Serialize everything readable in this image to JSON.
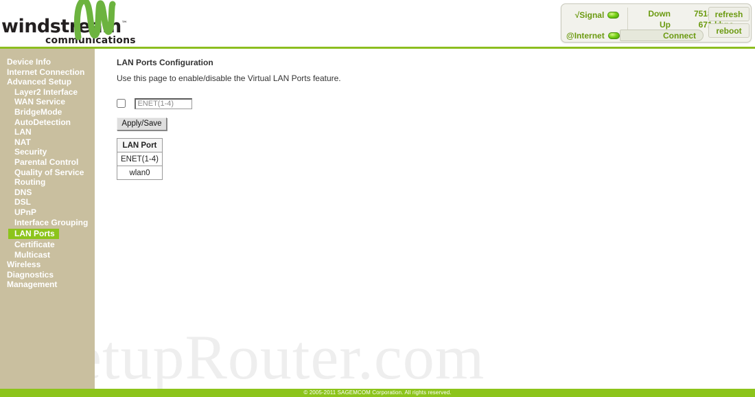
{
  "brand": {
    "name": "windstream",
    "trademark": "™",
    "tagline": "communications",
    "logo_icon": "windstream-wave-logo",
    "logo_color": "#6cb33f"
  },
  "status_panel": {
    "signal_label": "√Signal",
    "signal_led": "green",
    "internet_label": "@Internet",
    "internet_led": "green",
    "connect_label": "Connect",
    "rates": [
      {
        "name": "Down",
        "value": "7518 kbps"
      },
      {
        "name": "Up",
        "value": "671 kbps"
      }
    ],
    "buttons": [
      {
        "label": "refresh",
        "name": "refresh-button"
      },
      {
        "label": "reboot",
        "name": "reboot-button"
      }
    ],
    "accent_color": "#6b9a10"
  },
  "sidebar": {
    "background_color": "#c9bf9f",
    "active_color": "#8cc41b",
    "items": [
      {
        "label": "Device Info",
        "level": 1,
        "active": false
      },
      {
        "label": "Internet Connection",
        "level": 1,
        "active": false
      },
      {
        "label": "Advanced Setup",
        "level": 1,
        "active": false
      },
      {
        "label": "Layer2 Interface",
        "level": 2,
        "active": false
      },
      {
        "label": "WAN Service",
        "level": 2,
        "active": false
      },
      {
        "label": "BridgeMode",
        "level": 2,
        "active": false
      },
      {
        "label": "AutoDetection",
        "level": 2,
        "active": false
      },
      {
        "label": "LAN",
        "level": 2,
        "active": false
      },
      {
        "label": "NAT",
        "level": 2,
        "active": false
      },
      {
        "label": "Security",
        "level": 2,
        "active": false
      },
      {
        "label": "Parental Control",
        "level": 2,
        "active": false
      },
      {
        "label": "Quality of Service",
        "level": 2,
        "active": false
      },
      {
        "label": "Routing",
        "level": 2,
        "active": false
      },
      {
        "label": "DNS",
        "level": 2,
        "active": false
      },
      {
        "label": "DSL",
        "level": 2,
        "active": false
      },
      {
        "label": "UPnP",
        "level": 2,
        "active": false
      },
      {
        "label": "Interface Grouping",
        "level": 2,
        "active": false
      },
      {
        "label": "LAN Ports",
        "level": 2,
        "active": true
      },
      {
        "label": "Certificate",
        "level": 2,
        "active": false
      },
      {
        "label": "Multicast",
        "level": 2,
        "active": false
      },
      {
        "label": "Wireless",
        "level": 1,
        "active": false
      },
      {
        "label": "Diagnostics",
        "level": 1,
        "active": false
      },
      {
        "label": "Management",
        "level": 1,
        "active": false
      }
    ]
  },
  "main": {
    "title": "LAN Ports Configuration",
    "description": "Use this page to enable/disable the Virtual LAN Ports feature.",
    "vlan_enable": {
      "checked": false,
      "input_value": "ENET(1-4)"
    },
    "apply_save_label": "Apply/Save",
    "table": {
      "header": "LAN Port",
      "rows": [
        "ENET(1-4)",
        "wlan0"
      ]
    }
  },
  "watermark": "SetupRouter.com",
  "footer": {
    "text": "© 2005-2011 SAGEMCOM Corporation. All rights reserved.",
    "background_color": "#8cc41b"
  }
}
